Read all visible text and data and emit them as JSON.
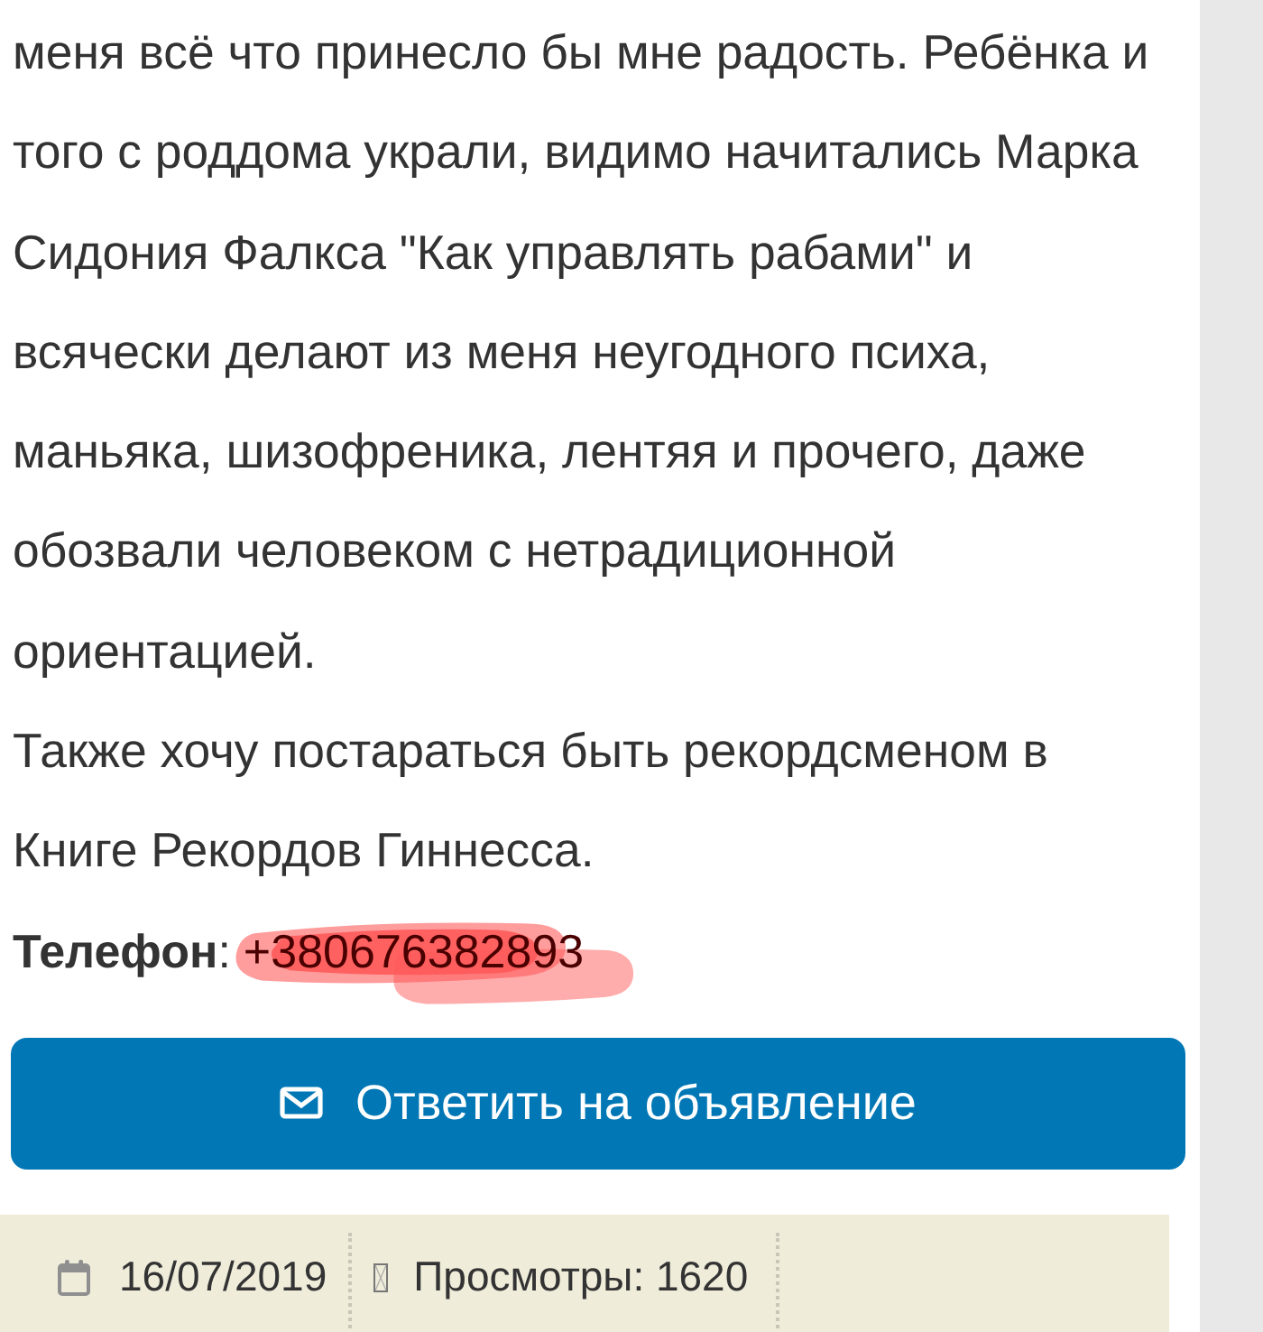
{
  "paragraphs": [
    {
      "lines": [
        "меня всё что принесло бы мне радость. Ребёнка и",
        "того с роддома украли, видимо начитались Марка",
        "Сидония Фалкса \"Как управлять рабами\" и",
        "всячески делают из меня неугодного психа,",
        "маньяка, шизофреника, лентяя и прочего, даже",
        "обозвали человеком с нетрадиционной",
        "ориентацией."
      ]
    },
    {
      "lines": [
        "Также хочу постараться быть рекордсменом в",
        "Книге Рекордов Гиннесса."
      ]
    }
  ],
  "phone": {
    "label": "**Телефон**:",
    "value": "+380676382893",
    "scribbled": true
  },
  "reply_button": {
    "label": "Ответить на объявление"
  },
  "meta": [
    {
      "kind": "date",
      "text": "16/07/2019"
    },
    {
      "kind": "views",
      "text": "Просмотры: 1620"
    }
  ]
}
